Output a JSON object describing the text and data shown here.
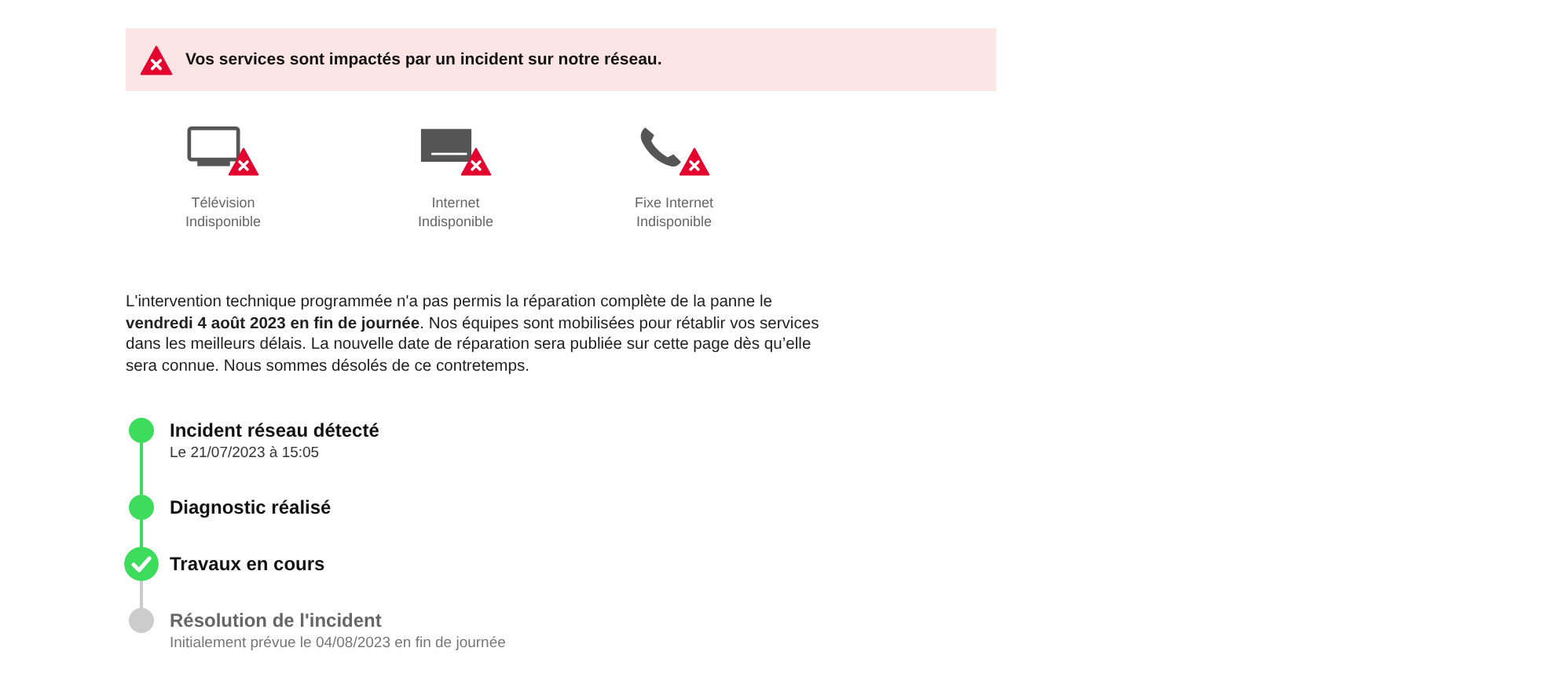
{
  "alert": {
    "message": "Vos services sont impactés par un incident sur notre réseau."
  },
  "services": [
    {
      "kind": "tv",
      "name": "Télévision",
      "status": "Indisponible"
    },
    {
      "kind": "internet",
      "name": "Internet",
      "status": "Indisponible"
    },
    {
      "kind": "phone",
      "name": "Fixe Internet",
      "status": "Indisponible"
    }
  ],
  "message": "L'intervention technique programmée n'a pas permis la réparation complète de la panne le **vendredi 4 août 2023 en fin de journée**. Nos équipes sont mobilisées pour rétablir vos services dans les meilleurs délais. La nouvelle date de réparation sera publiée sur cette page dès qu’elle sera connue. Nous sommes désolés de ce contretemps.",
  "timeline": [
    {
      "done": true,
      "current": false,
      "title": "Incident réseau détecté",
      "detail": "Le 21/07/2023 à 15:05"
    },
    {
      "done": true,
      "current": false,
      "title": "Diagnostic réalisé"
    },
    {
      "done": true,
      "current": true,
      "title": "Travaux en cours"
    },
    {
      "done": false,
      "current": false,
      "title": "Résolution de l'incident",
      "detail": "Initialement prévue le 04/08/2023 en fin de journée"
    }
  ]
}
